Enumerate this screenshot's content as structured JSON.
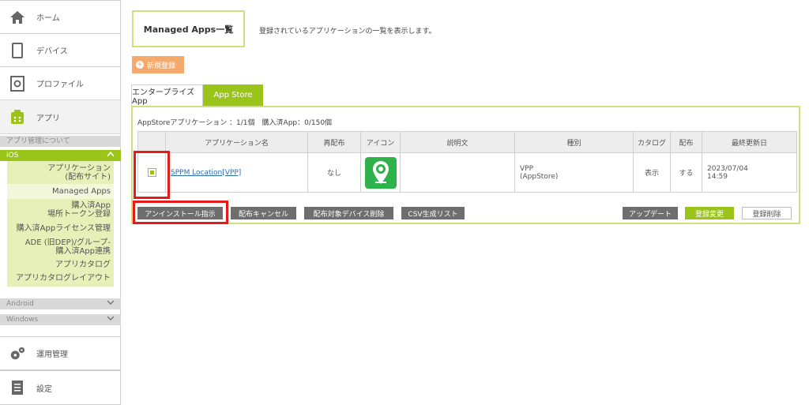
{
  "sidebar": {
    "items": [
      {
        "label": "ホーム",
        "icon": "home-icon"
      },
      {
        "label": "デバイス",
        "icon": "device-icon"
      },
      {
        "label": "プロファイル",
        "icon": "profile-icon"
      },
      {
        "label": "アプリ",
        "icon": "app-icon"
      }
    ],
    "app_mgmt_header": "アプリ管理について",
    "ios": {
      "label": "iOS",
      "sub_items": [
        "アプリケーション\n(配布サイト)",
        "Managed Apps",
        "購入済App\n場所トークン登録",
        "購入済Appライセンス管理",
        "ADE (旧DEP)/グループ-\n購入済App連携",
        "アプリカタログ",
        "アプリカタログレイアウト"
      ]
    },
    "android_label": "Android",
    "windows_label": "Windows",
    "ops": {
      "label": "運用管理",
      "icon": "gears-icon"
    },
    "settings": {
      "label": "設定",
      "icon": "settings-doc-icon"
    }
  },
  "header": {
    "title": "Managed Apps一覧",
    "description": "登録されているアプリケーションの一覧を表示します。"
  },
  "new_button": "新規登録",
  "tabs": [
    "エンタープライズApp",
    "App Store"
  ],
  "panel": {
    "count_text": "AppStoreアプリケーション ：1/1個　購入済App：0/150個",
    "columns": [
      "",
      "アプリケーション名",
      "再配布",
      "アイコン",
      "説明文",
      "種別",
      "カタログ",
      "配布",
      "最終更新日"
    ],
    "rows": [
      {
        "name": "SPPM Location[VPP]",
        "redistribute": "なし",
        "description": "",
        "kind_line1": "VPP",
        "kind_line2": "(AppStore)",
        "catalog": "表示",
        "distribute": "する",
        "updated_line1": "2023/07/04",
        "updated_line2": "14:59"
      }
    ],
    "buttons_left": [
      "アンインストール指示",
      "配布キャンセル",
      "配布対象デバイス削除",
      "CSV生成リスト"
    ],
    "buttons_right": [
      "アップデート",
      "登録変更",
      "登録削除"
    ]
  },
  "colors": {
    "accent_green": "#9ac41a",
    "highlight_red": "#e51a1a",
    "new_orange": "#f5a96a"
  }
}
